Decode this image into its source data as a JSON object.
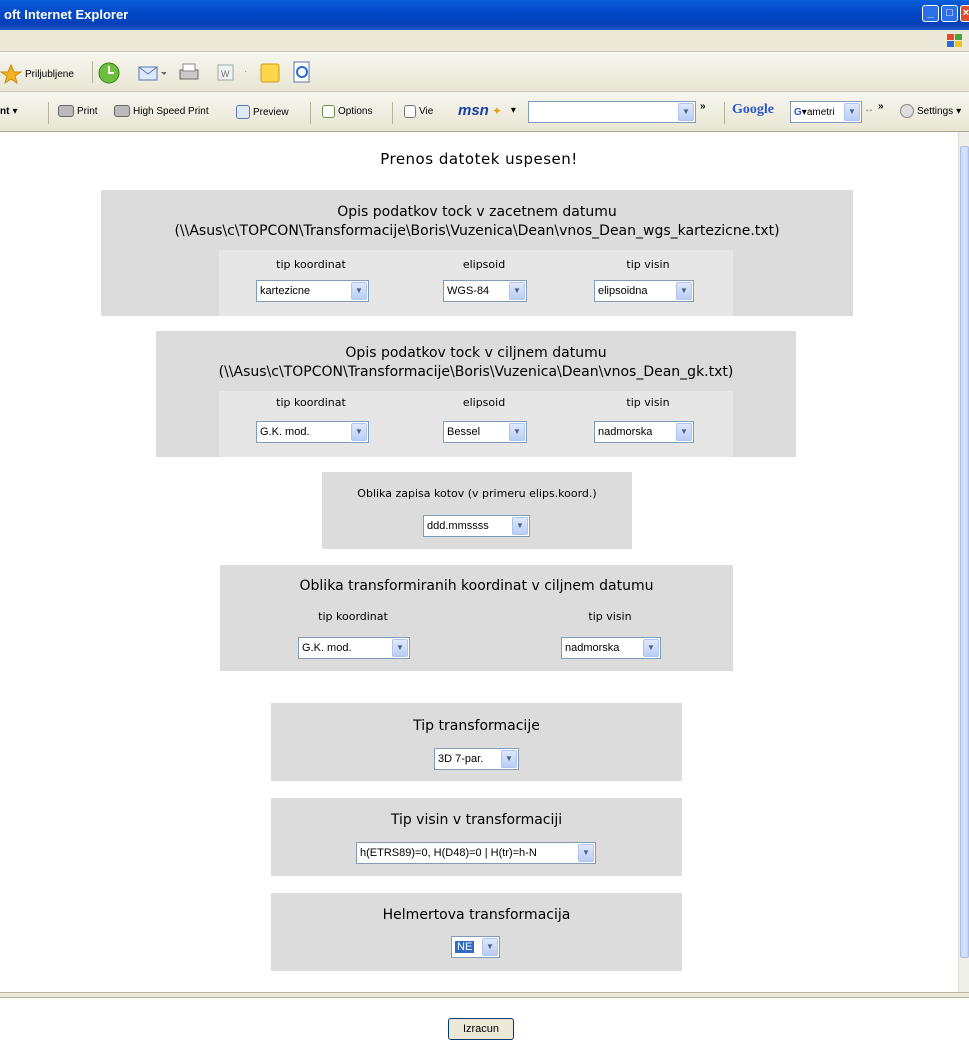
{
  "window": {
    "title": "oft Internet Explorer"
  },
  "toolbar": {
    "favorites_label": "Priljubljene",
    "left_cut_label": "nt",
    "print_label": "Print",
    "high_speed_print_label": "High Speed Print",
    "preview_label": "Preview",
    "options_label": "Options",
    "view_label": "Vie",
    "msn_label": "msn",
    "google_label": "Google",
    "google_search_text": "ametri",
    "settings_label": "Settings"
  },
  "page": {
    "message": "Prenos datotek uspesen!",
    "source": {
      "title_line1": "Opis podatkov tock v zacetnem datumu",
      "title_line2": "(\\\\Asus\\c\\TOPCON\\Transformacije\\Boris\\Vuzenica\\Dean\\vnos_Dean_wgs_kartezicne.txt)",
      "coord_type_label": "tip koordinat",
      "coord_type_value": "kartezicne",
      "ellipsoid_label": "elipsoid",
      "ellipsoid_value": "WGS-84",
      "height_type_label": "tip visin",
      "height_type_value": "elipsoidna"
    },
    "target": {
      "title_line1": "Opis podatkov tock v ciljnem datumu",
      "title_line2": "(\\\\Asus\\c\\TOPCON\\Transformacije\\Boris\\Vuzenica\\Dean\\vnos_Dean_gk.txt)",
      "coord_type_label": "tip koordinat",
      "coord_type_value": "G.K. mod.",
      "ellipsoid_label": "elipsoid",
      "ellipsoid_value": "Bessel",
      "height_type_label": "tip visin",
      "height_type_value": "nadmorska"
    },
    "angle_format": {
      "title": "Oblika zapisa kotov (v primeru elips.koord.)",
      "value": "ddd.mmssss"
    },
    "output_format": {
      "title": "Oblika transformiranih koordinat v ciljnem datumu",
      "coord_type_label": "tip koordinat",
      "coord_type_value": "G.K. mod.",
      "height_type_label": "tip visin",
      "height_type_value": "nadmorska"
    },
    "transformation_type": {
      "title": "Tip transformacije",
      "value": "3D 7-par."
    },
    "height_type_transformation": {
      "title": "Tip visin v transformaciji",
      "value": "h(ETRS89)=0, H(D48)=0 | H(tr)=h-N"
    },
    "helmert": {
      "title": "Helmertova transformacija",
      "value": "NE"
    },
    "bottom_button_label": "Izracun"
  }
}
